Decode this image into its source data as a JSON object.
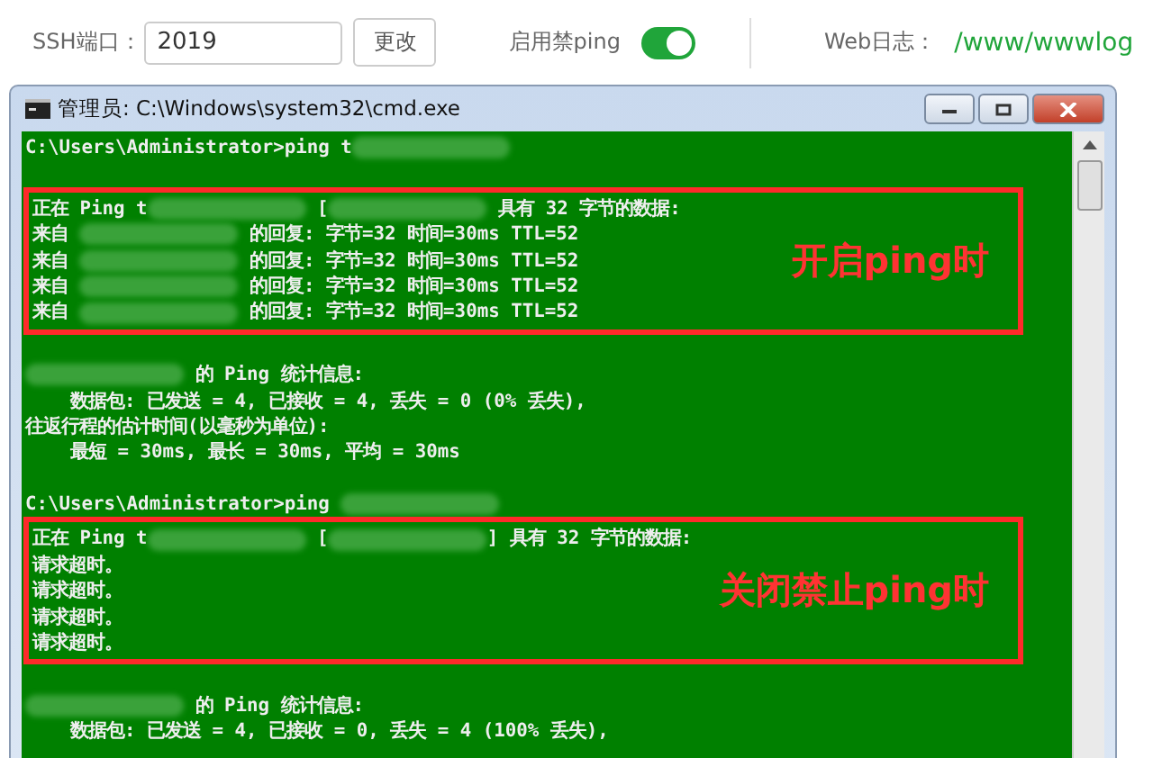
{
  "settings": {
    "ssh_port_label": "SSH端口：",
    "ssh_port": "2019",
    "change_button": "更改",
    "ping_toggle_label": "启用禁ping",
    "ping_block_on": true,
    "web_log_label": "Web日志：",
    "web_log_path": "/www/wwwlog"
  },
  "window": {
    "title": "管理员: C:\\Windows\\system32\\cmd.exe"
  },
  "console": [
    {
      "kind": "line",
      "segments": [
        {
          "kind": "text",
          "text": "C:\\Users\\Administrator>ping t"
        },
        {
          "kind": "redacted"
        }
      ]
    },
    {
      "kind": "blank"
    },
    {
      "kind": "highlight",
      "note": "开启ping时",
      "lines": [
        {
          "segments": [
            {
              "kind": "text",
              "text": "正在 Ping t"
            },
            {
              "kind": "redacted"
            },
            {
              "kind": "text",
              "text": " ["
            },
            {
              "kind": "redacted"
            },
            {
              "kind": "text",
              "text": " 具有 32 字节的数据:"
            }
          ]
        },
        {
          "segments": [
            {
              "kind": "text",
              "text": "来自 "
            },
            {
              "kind": "redacted"
            },
            {
              "kind": "text",
              "text": " 的回复: 字节=32 时间=30ms TTL=52"
            }
          ]
        },
        {
          "segments": [
            {
              "kind": "text",
              "text": "来自 "
            },
            {
              "kind": "redacted"
            },
            {
              "kind": "text",
              "text": " 的回复: 字节=32 时间=30ms TTL=52"
            }
          ]
        },
        {
          "segments": [
            {
              "kind": "text",
              "text": "来自 "
            },
            {
              "kind": "redacted"
            },
            {
              "kind": "text",
              "text": " 的回复: 字节=32 时间=30ms TTL=52"
            }
          ]
        },
        {
          "segments": [
            {
              "kind": "text",
              "text": "来自 "
            },
            {
              "kind": "redacted"
            },
            {
              "kind": "text",
              "text": " 的回复: 字节=32 时间=30ms TTL=52"
            }
          ]
        }
      ]
    },
    {
      "kind": "blank"
    },
    {
      "kind": "line",
      "segments": [
        {
          "kind": "redacted"
        },
        {
          "kind": "text",
          "text": " 的 Ping 统计信息:"
        }
      ]
    },
    {
      "kind": "line",
      "segments": [
        {
          "kind": "text",
          "text": "    数据包: 已发送 = 4, 已接收 = 4, 丢失 = 0 (0% 丢失),"
        }
      ]
    },
    {
      "kind": "line",
      "segments": [
        {
          "kind": "text",
          "text": "往返行程的估计时间(以毫秒为单位):"
        }
      ]
    },
    {
      "kind": "line",
      "segments": [
        {
          "kind": "text",
          "text": "    最短 = 30ms, 最长 = 30ms, 平均 = 30ms"
        }
      ]
    },
    {
      "kind": "blank"
    },
    {
      "kind": "line",
      "segments": [
        {
          "kind": "text",
          "text": "C:\\Users\\Administrator>ping "
        },
        {
          "kind": "redacted"
        }
      ]
    },
    {
      "kind": "highlight",
      "note": "关闭禁止ping时",
      "lines": [
        {
          "segments": [
            {
              "kind": "text",
              "text": "正在 Ping t"
            },
            {
              "kind": "redacted"
            },
            {
              "kind": "text",
              "text": " ["
            },
            {
              "kind": "redacted"
            },
            {
              "kind": "text",
              "text": "] 具有 32 字节的数据:"
            }
          ]
        },
        {
          "segments": [
            {
              "kind": "text",
              "text": "请求超时。"
            }
          ]
        },
        {
          "segments": [
            {
              "kind": "text",
              "text": "请求超时。"
            }
          ]
        },
        {
          "segments": [
            {
              "kind": "text",
              "text": "请求超时。"
            }
          ]
        },
        {
          "segments": [
            {
              "kind": "text",
              "text": "请求超时。"
            }
          ]
        }
      ]
    },
    {
      "kind": "blank"
    },
    {
      "kind": "line",
      "segments": [
        {
          "kind": "redacted"
        },
        {
          "kind": "text",
          "text": " 的 Ping 统计信息:"
        }
      ]
    },
    {
      "kind": "line",
      "segments": [
        {
          "kind": "text",
          "text": "    数据包: 已发送 = 4, 已接收 = 0, 丢失 = 4 (100% 丢失),"
        }
      ]
    }
  ]
}
